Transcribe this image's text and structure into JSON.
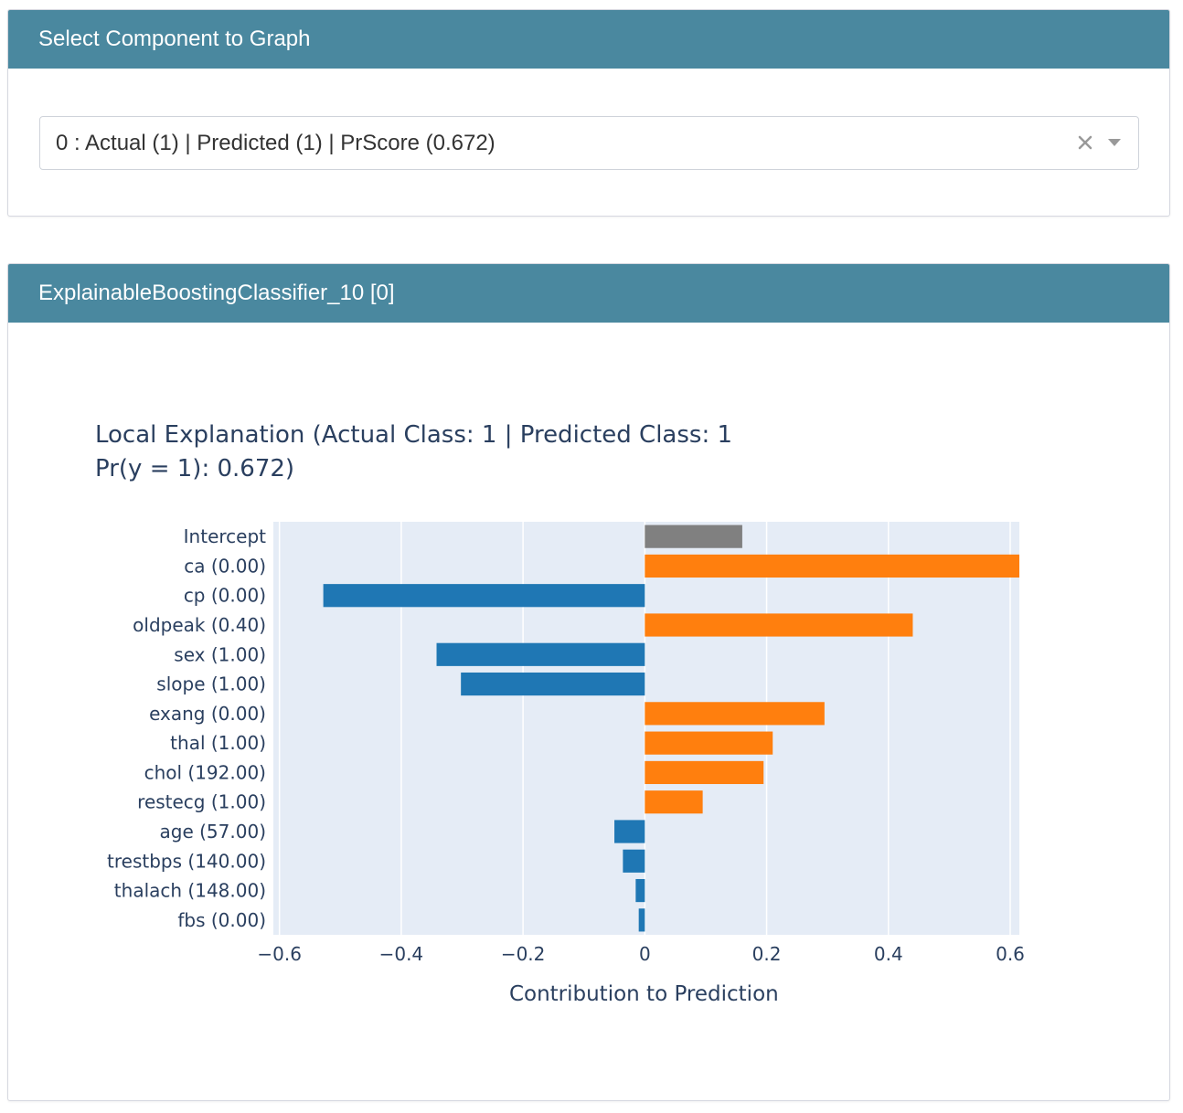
{
  "component_selector": {
    "header": "Select Component to Graph",
    "selected_value": "0 : Actual (1) | Predicted (1) | PrScore (0.672)",
    "clear_icon": "close-icon",
    "dropdown_icon": "chevron-down-icon"
  },
  "explanation_card": {
    "header": "ExplainableBoostingClassifier_10 [0]"
  },
  "colors": {
    "header_bg": "#4a889f",
    "plot_bg": "#e5ecf6",
    "positive": "#ff7f0e",
    "negative": "#1f77b4",
    "intercept": "#808080"
  },
  "chart_data": {
    "type": "bar",
    "orientation": "horizontal",
    "title_line1": "Local Explanation (Actual Class: 1 | Predicted Class: 1",
    "title_line2": "Pr(y = 1): 0.672)",
    "xlabel": "Contribution to Prediction",
    "ylabel": "",
    "xlim": [
      -0.61,
      0.615
    ],
    "xticks": [
      -0.6,
      -0.4,
      -0.2,
      0,
      0.2,
      0.4,
      0.6
    ],
    "xtick_labels": [
      "−0.6",
      "−0.4",
      "−0.2",
      "0",
      "0.2",
      "0.4",
      "0.6"
    ],
    "grid": true,
    "categories": [
      "Intercept",
      "ca (0.00)",
      "cp (0.00)",
      "oldpeak (0.40)",
      "sex (1.00)",
      "slope (1.00)",
      "exang (0.00)",
      "thal (1.00)",
      "chol (192.00)",
      "restecg (1.00)",
      "age (57.00)",
      "trestbps (140.00)",
      "thalach (148.00)",
      "fbs (0.00)"
    ],
    "values": [
      0.16,
      0.615,
      -0.528,
      0.44,
      -0.342,
      -0.302,
      0.295,
      0.21,
      0.195,
      0.095,
      -0.05,
      -0.036,
      -0.015,
      -0.01
    ]
  }
}
